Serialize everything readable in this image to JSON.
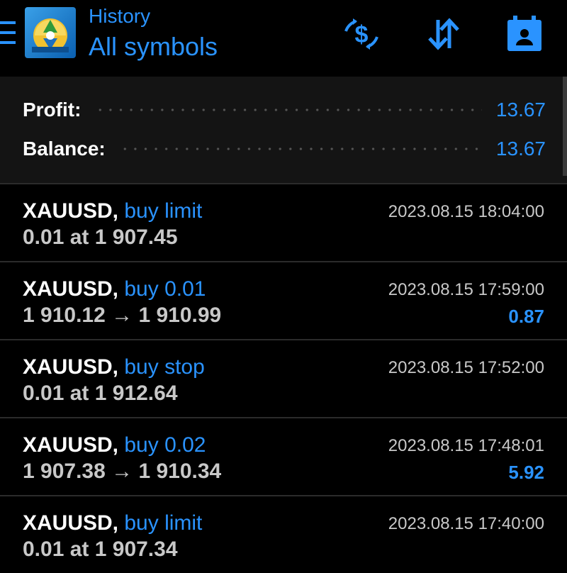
{
  "header": {
    "title_small": "History",
    "title_large": "All symbols",
    "menu_icon": "hamburger-menu-icon",
    "logo_icon": "metatrader-logo-icon",
    "actions": [
      {
        "icon": "currency-exchange-icon"
      },
      {
        "icon": "sort-icon"
      },
      {
        "icon": "calendar-icon"
      }
    ]
  },
  "summary": {
    "profit_label": "Profit:",
    "profit_value": "13.67",
    "balance_label": "Balance:",
    "balance_value": "13.67"
  },
  "items": [
    {
      "symbol": "XAUUSD,",
      "action": "buy limit",
      "detail": "0.01 at 1 907.45",
      "time": "2023.08.15 18:04:00",
      "profit": ""
    },
    {
      "symbol": "XAUUSD,",
      "action": "buy 0.01",
      "detail": "1 910.12 → 1 910.99",
      "time": "2023.08.15 17:59:00",
      "profit": "0.87"
    },
    {
      "symbol": "XAUUSD,",
      "action": "buy stop",
      "detail": "0.01 at 1 912.64",
      "time": "2023.08.15 17:52:00",
      "profit": ""
    },
    {
      "symbol": "XAUUSD,",
      "action": "buy 0.02",
      "detail": "1 907.38 → 1 910.34",
      "time": "2023.08.15 17:48:01",
      "profit": "5.92"
    },
    {
      "symbol": "XAUUSD,",
      "action": "buy limit",
      "detail": "0.01 at 1 907.34",
      "time": "2023.08.15 17:40:00",
      "profit": ""
    }
  ],
  "colors": {
    "accent": "#2a93ff",
    "background": "#000000",
    "summary_background": "#141414",
    "muted_text": "#c8c8c8",
    "divider": "#2b2b2b"
  }
}
